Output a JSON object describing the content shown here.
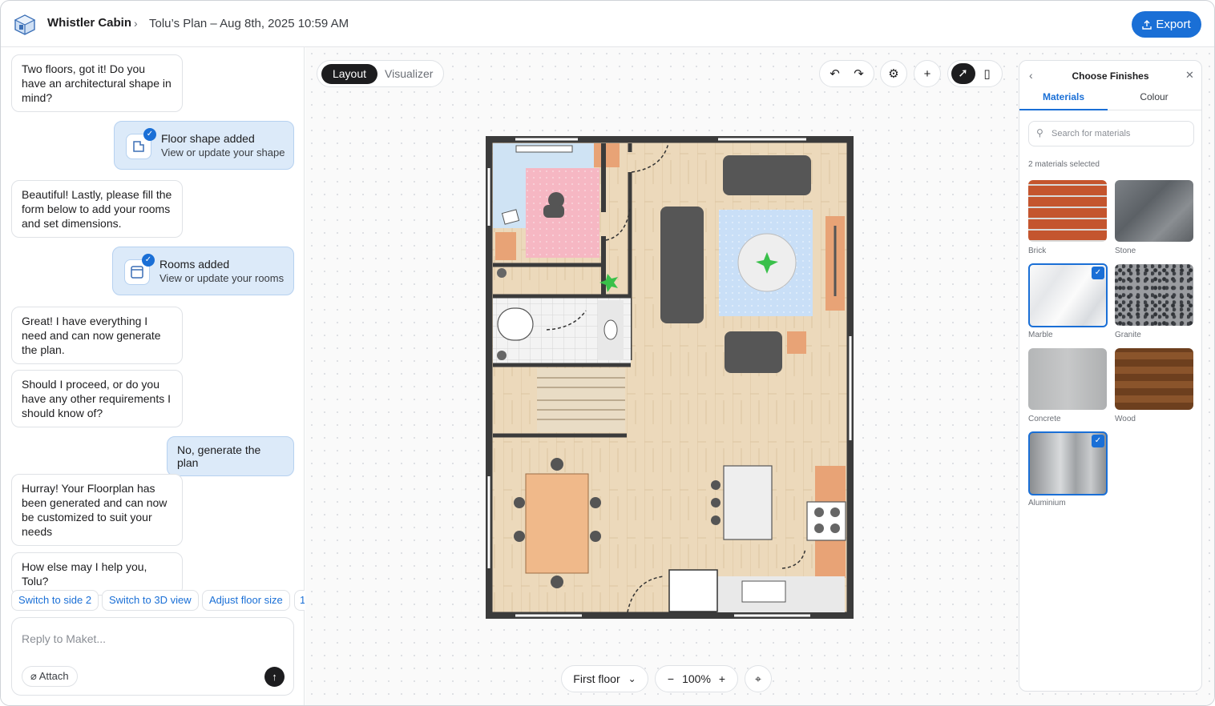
{
  "header": {
    "project": "Whistler Cabin",
    "breadcrumb": "Tolu’s Plan – Aug 8th, 2025 10:59 AM",
    "export_label": "Export"
  },
  "chat": {
    "msg1": "Two floors, got it! Do you have an architectural shape in mind?",
    "card1_title": "Floor shape added",
    "card1_sub": "View or update your shape",
    "msg2": "Beautiful! Lastly, please fill the form below to add your rooms and set dimensions.",
    "card2_title": "Rooms added",
    "card2_sub": "View or update your rooms",
    "msg3": "Great! I have everything I need and can now generate the plan.",
    "msg4": "Should I proceed, or do you have any other requirements I should know of?",
    "user_msg": "No, generate the plan",
    "msg5": "Hurray! Your Floorplan has been generated and can now be customized to suit your needs",
    "msg6": "How else may I help you, Tolu?",
    "chips": [
      "Switch to side 2",
      "Switch to 3D view",
      "Adjust floor size",
      "1"
    ],
    "reply_placeholder": "Reply to Maket...",
    "attach_label": "Attach"
  },
  "canvas": {
    "mode_active": "Layout",
    "mode_inactive": "Visualizer",
    "floor_select": "First floor",
    "zoom": "100%"
  },
  "finishes": {
    "title": "Choose Finishes",
    "tab_materials": "Materials",
    "tab_colour": "Colour",
    "search_placeholder": "Search for materials",
    "selected_count": "2 materials selected",
    "materials": [
      {
        "name": "Brick",
        "selected": false,
        "color": "#c4552e"
      },
      {
        "name": "Stone",
        "selected": false,
        "color": "#6f7478"
      },
      {
        "name": "Marble",
        "selected": true,
        "color": "#eef0f2"
      },
      {
        "name": "Granite",
        "selected": false,
        "color": "#8a8d92"
      },
      {
        "name": "Concrete",
        "selected": false,
        "color": "#b9bbbc"
      },
      {
        "name": "Wood",
        "selected": false,
        "color": "#7a4a26"
      },
      {
        "name": "Aluminium",
        "selected": true,
        "color": "#a9acaf"
      }
    ]
  },
  "colors": {
    "accent": "#1a6fd6",
    "card_bg": "#dceaf9"
  }
}
